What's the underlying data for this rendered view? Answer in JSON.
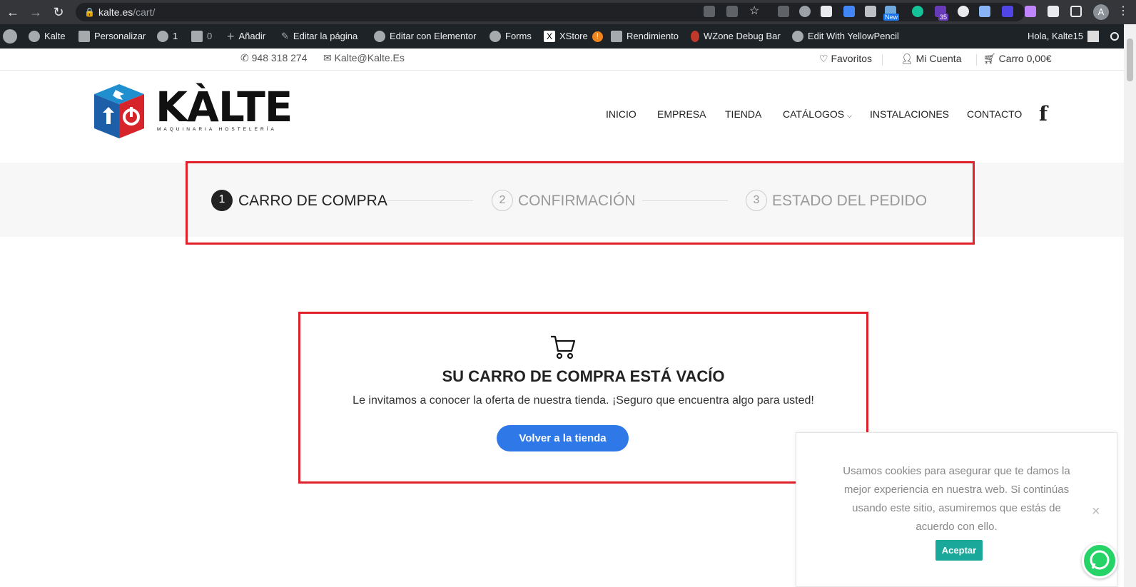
{
  "browser": {
    "url_host": "kalte.es",
    "url_path": "/cart/",
    "profile_initial": "A",
    "ext_badge_new": "New",
    "ext_badge_count": "35"
  },
  "wpbar": {
    "site": "Kalte",
    "customize": "Personalizar",
    "updates": "1",
    "comments": "0",
    "add": "Añadir",
    "edit_page": "Editar la página",
    "elementor": "Editar con Elementor",
    "forms": "Forms",
    "xstore": "XStore",
    "performance": "Rendimiento",
    "wzone": "WZone Debug Bar",
    "yellowpencil": "Edit With YellowPencil",
    "greeting": "Hola, Kalte15"
  },
  "topbar": {
    "phone": "948 318 274",
    "email": "Kalte@Kalte.Es",
    "favorites": "Favoritos",
    "account": "Mi Cuenta",
    "cart": "Carro",
    "cart_total": "0,00€"
  },
  "logo": {
    "name": "KÀLTE",
    "tagline": "MAQUINARIA   HOSTELERÍA"
  },
  "menu": [
    "INICIO",
    "EMPRESA",
    "TIENDA",
    "CATÁLOGOS",
    "INSTALACIONES",
    "CONTACTO"
  ],
  "steps": [
    {
      "num": "1",
      "label": "CARRO DE COMPRA"
    },
    {
      "num": "2",
      "label": "CONFIRMACIÓN"
    },
    {
      "num": "3",
      "label": "ESTADO DEL PEDIDO"
    }
  ],
  "empty_cart": {
    "title": "SU CARRO DE COMPRA ESTÁ VACÍO",
    "text": "Le invitamos a conocer la oferta de nuestra tienda. ¡Seguro que encuentra algo para usted!",
    "button": "Volver a la tienda"
  },
  "cookie": {
    "text": "Usamos cookies para asegurar que te damos la mejor experiencia en nuestra web. Si continúas usando este sitio, asumiremos que estás de acuerdo con ello.",
    "accept": "Aceptar",
    "close": "×"
  },
  "colors": {
    "accent_blue": "#2f78e8",
    "highlight_red": "#e0202a",
    "cookie_teal": "#1aa89a",
    "whatsapp": "#25d366"
  }
}
